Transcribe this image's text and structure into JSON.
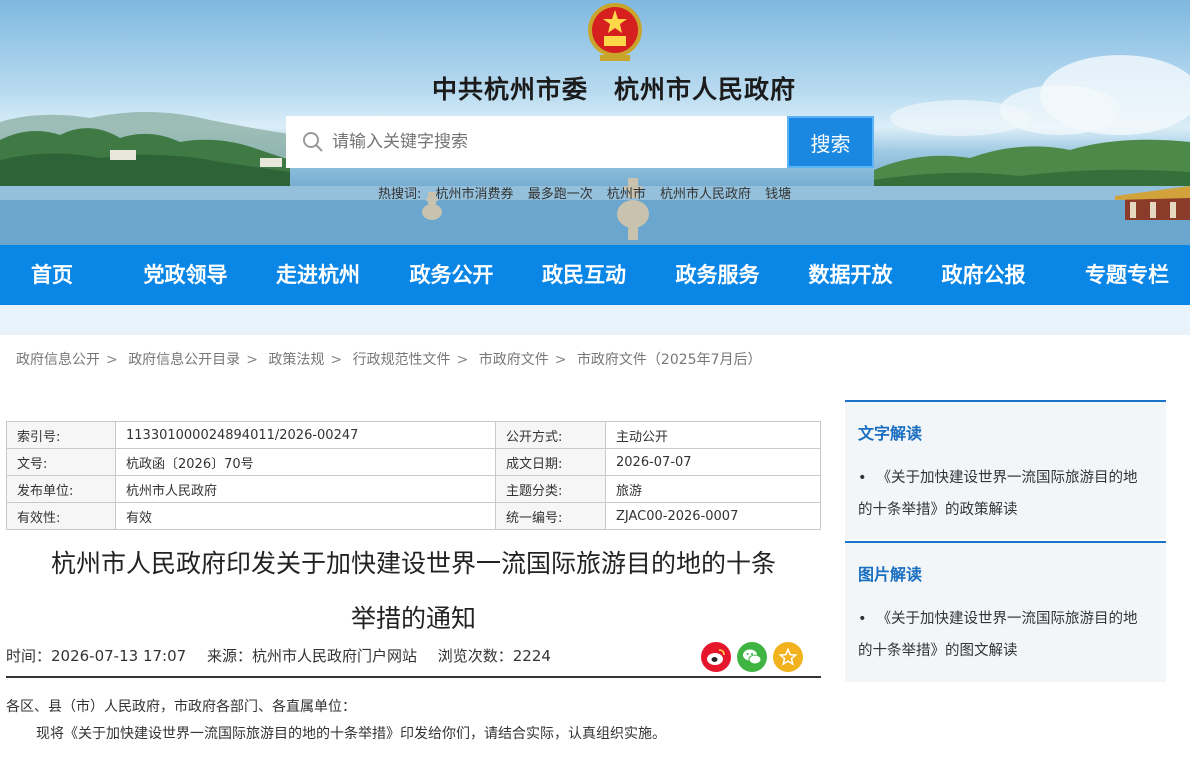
{
  "header": {
    "site_title": "中共杭州市委　杭州市人民政府",
    "search_placeholder": "请输入关键字搜索",
    "search_button": "搜索",
    "hot_words": [
      "热搜词:",
      "杭州市消费券",
      "最多跑一次",
      "杭州市",
      "杭州市人民政府",
      "钱塘"
    ]
  },
  "nav": {
    "items": [
      "首页",
      "党政领导",
      "走进杭州",
      "政务公开",
      "政民互动",
      "政务服务",
      "数据开放",
      "政府公报",
      "专题专栏"
    ]
  },
  "breadcrumb": [
    "政府信息公开",
    "政府信息公开目录",
    "政策法规",
    "行政规范性文件",
    "市政府文件",
    "市政府文件（2025年7月后）"
  ],
  "info": {
    "rows": [
      {
        "k1": "索引号:",
        "v1": "113301000024894011/2026-00247",
        "k2": "公开方式:",
        "v2": "主动公开"
      },
      {
        "k1": "文号:",
        "v1": "杭政函〔2026〕70号",
        "k2": "成文日期:",
        "v2": "2026-07-07"
      },
      {
        "k1": "发布单位:",
        "v1": "杭州市人民政府",
        "k2": "主题分类:",
        "v2": "旅游"
      },
      {
        "k1": "有效性:",
        "v1": "有效",
        "k2": "统一编号:",
        "v2": "ZJAC00-2026-0007"
      }
    ]
  },
  "article": {
    "title_line1": "杭州市人民政府印发关于加快建设世界一流国际旅游目的地的十条",
    "title_line2": "举措的通知",
    "time": "时间：2026-07-13 17:07",
    "source": "来源：杭州市人民政府门户网站",
    "views": "浏览次数：2224",
    "salutation": "各区、县（市）人民政府，市政府各部门、各直属单位：",
    "paragraph1": "现将《关于加快建设世界一流国际旅游目的地的十条举措》印发给你们，请结合实际，认真组织实施。"
  },
  "sidebar": {
    "text_reading": {
      "heading": "文字解读",
      "bullet": "•",
      "item": "《关于加快建设世界一流国际旅游目的地的十条举措》的政策解读"
    },
    "image_reading": {
      "heading": "图片解读",
      "bullet": "•",
      "item": "《关于加快建设世界一流国际旅游目的地的十条举措》的图文解读"
    }
  },
  "colors": {
    "nav_blue": "#0a86e6",
    "search_button": "#1a87e0",
    "sidebar_heading": "#1a6fc0",
    "weibo": "#e6162d",
    "wechat": "#3fb442",
    "favorite": "#f1b21e"
  },
  "icons": {
    "search": "search-icon",
    "weibo": "weibo-icon",
    "wechat": "wechat-icon",
    "favorite": "star-icon",
    "emblem": "national-emblem-icon"
  }
}
